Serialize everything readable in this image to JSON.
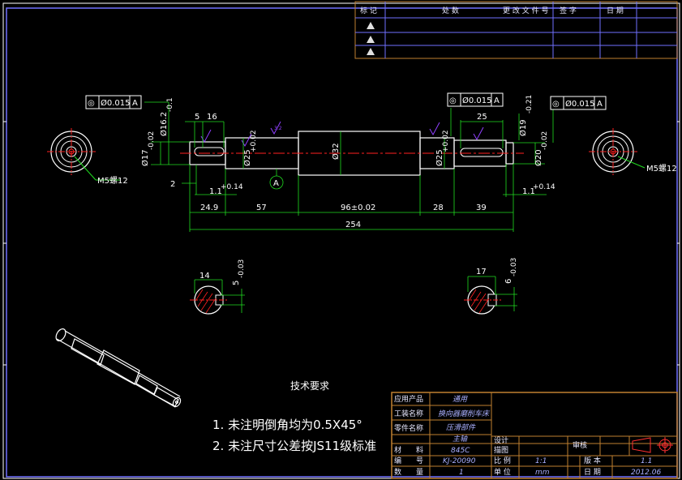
{
  "dims": {
    "d5": "5",
    "d16": "16",
    "d25top": "25",
    "dia_16_2": "Ø16.2",
    "dia_16_2_tol": "-0.1",
    "dia_17": "Ø17",
    "dia_17_tol": "-0.02",
    "dia_25_left": "Ø25",
    "dia_25_left_tol": "+0.02",
    "dia_32": "Ø32",
    "dia_25_right": "Ø25",
    "dia_25_right_tol": "+0.02",
    "dia_19": "Ø19",
    "dia_19_tol": "-0.21",
    "dia_20": "Ø20",
    "dia_20_tol": "-0.02",
    "d2": "2",
    "chamfer_left": "1.1",
    "chamfer_left_tol": "+0.14",
    "chamfer_right": "1.1",
    "chamfer_right_tol": "+0.14",
    "d24_9": "24.9",
    "d57": "57",
    "d96": "96±0.02",
    "d28": "28",
    "d39": "39",
    "d254": "254",
    "m5_left": "M5螺12",
    "m5_right": "M5螺12",
    "datum": "A",
    "rough": "3.2",
    "sec_left_w": "14",
    "sec_left_d": "5",
    "sec_left_tol": "-0.03",
    "sec_right_w": "17",
    "sec_right_d": "6",
    "sec_right_tol": "-0.03"
  },
  "fcf": [
    {
      "sym": "◎",
      "val": "Ø0.015",
      "ref": "A"
    },
    {
      "sym": "◎",
      "val": "Ø0.015",
      "ref": "A"
    },
    {
      "sym": "◎",
      "val": "Ø0.015",
      "ref": "A"
    }
  ],
  "notes": {
    "title": "技术要求",
    "line1": "1. 未注明倒角均为0.5X45°",
    "line2": "2. 未注尺寸公差按JS11级标准"
  },
  "revision": {
    "headers": [
      "标 记",
      "处 数",
      "更 改 文 件 号",
      "签 字",
      "日 期"
    ],
    "rows": 3
  },
  "title_block": {
    "product_label": "应用产品",
    "product_value": "通用",
    "process_label": "工装名称",
    "process_value": "换向器磨削车床",
    "part_label": "零件名称",
    "part_value": "压滑部件",
    "part_value2": "主轴",
    "material_label": "材　　料",
    "material_value": "845C",
    "number_label": "编　　号",
    "number_value": "KJ-20090",
    "qty_label": "数　　量",
    "qty_value": "1",
    "design_label": "设计",
    "check_label": "描图",
    "review_label": "审核",
    "scale_label": "比 例",
    "scale_value": "1:1",
    "unit_label": "单 位",
    "unit_value": "mm",
    "version_label": "版 本",
    "version_value": "1.1",
    "date_label": "日 期",
    "date_value": "2012.06"
  },
  "colors": {
    "outline": "#ffffff",
    "center": "#ff2020",
    "dim": "#20dd20",
    "table": "#c08030",
    "border": "#7070ff"
  }
}
